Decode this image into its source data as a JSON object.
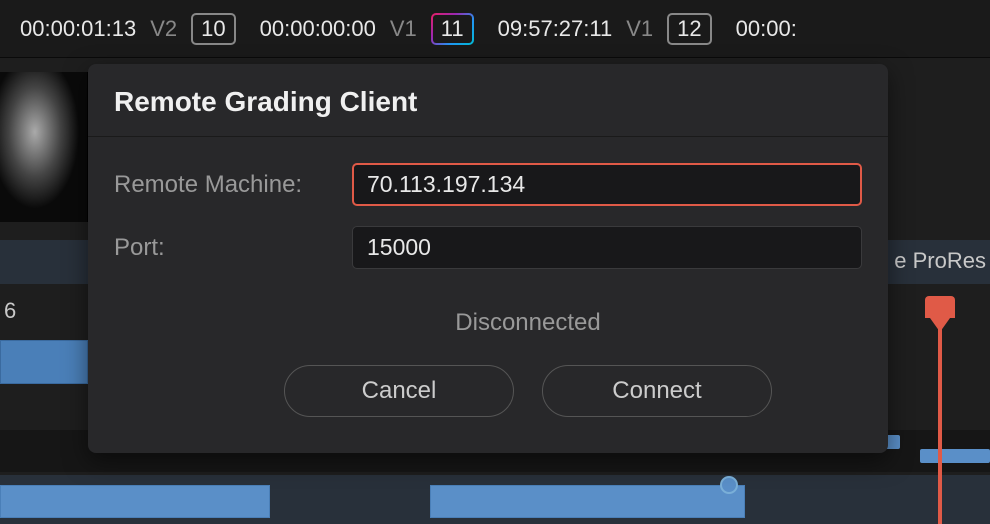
{
  "toolbar": {
    "segments": [
      {
        "timecode": "00:00:01:13",
        "track": "V2",
        "number": "10",
        "highlighted": false
      },
      {
        "timecode": "00:00:00:00",
        "track": "V1",
        "number": "11",
        "highlighted": true
      },
      {
        "timecode": "09:57:27:11",
        "track": "V1",
        "number": "12",
        "highlighted": false
      }
    ],
    "overflow_timecode": "00:00:"
  },
  "dialog": {
    "title": "Remote Grading Client",
    "fields": {
      "remote_machine": {
        "label": "Remote Machine:",
        "value": "70.113.197.134"
      },
      "port": {
        "label": "Port:",
        "value": "15000"
      }
    },
    "status": "Disconnected",
    "buttons": {
      "cancel": "Cancel",
      "connect": "Connect"
    }
  },
  "background": {
    "codec_label": "e ProRes",
    "left_label": "6"
  }
}
